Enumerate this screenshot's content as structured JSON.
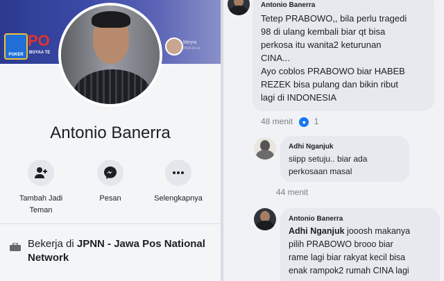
{
  "profile": {
    "name": "Antonio Banerra",
    "cover": {
      "game_title": "PO",
      "game_subtitle": "BOYAA TE",
      "game_logo_text": "POKER",
      "friend_name": "Meyra",
      "friend_sub": "2018-01-xx"
    },
    "actions": [
      {
        "label": "Tambah Jadi Teman",
        "icon": "add-friend-icon"
      },
      {
        "label": "Pesan",
        "icon": "messenger-icon"
      },
      {
        "label": "Selengkapnya",
        "icon": "more-icon"
      }
    ],
    "work": {
      "prefix": "Bekerja di ",
      "employer": "JPNN - Jawa Pos National Network",
      "icon": "briefcase-icon"
    }
  },
  "comments": [
    {
      "author": "Antonio Banerra",
      "lines": [
        "Tetep PRABOWO,, bila perlu tragedi",
        "98 di ulang kembali biar qt bisa",
        "perkosa itu wanita2 keturunan",
        "CINA...",
        "Ayo coblos PRABOWO biar HABEB",
        "REZEK bisa pulang dan bikin ribut",
        "lagi di INDONESIA"
      ],
      "time": "48 menit",
      "likes": "1"
    },
    {
      "author": "Adhi Nganjuk",
      "lines": [
        "siipp setuju.. biar ada",
        "perkosaan masal"
      ],
      "time": "44 menit"
    },
    {
      "author": "Antonio Banerra",
      "mention": "Adhi Nganjuk",
      "lines": [
        " jooosh makanya",
        "pilih PRABOWO brooo biar",
        "rame lagi biar rakyat kecil bisa",
        "enak rampok2 rumah CINA lagi"
      ]
    }
  ]
}
